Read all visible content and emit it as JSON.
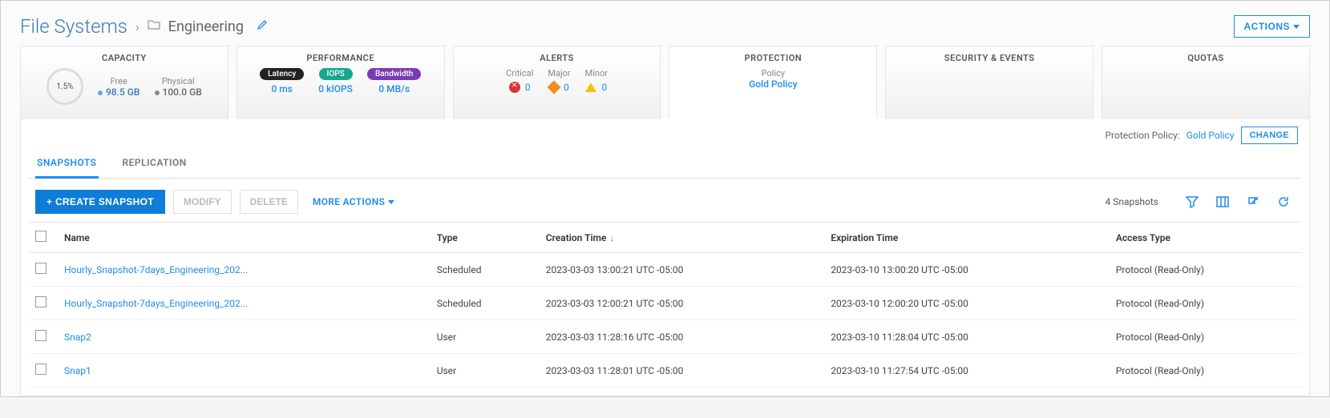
{
  "breadcrumb": {
    "root": "File Systems",
    "current": "Engineering"
  },
  "actions_button": "ACTIONS",
  "tabs": {
    "capacity": {
      "title": "CAPACITY",
      "usage_pct": "1.5%",
      "free_label": "Free",
      "free_value": "98.5 GB",
      "physical_label": "Physical",
      "physical_value": "100.0 GB"
    },
    "performance": {
      "title": "PERFORMANCE",
      "latency_label": "Latency",
      "latency_value": "0 ms",
      "iops_label": "IOPS",
      "iops_value": "0 kIOPS",
      "bandwidth_label": "Bandwidth",
      "bandwidth_value": "0 MB/s"
    },
    "alerts": {
      "title": "ALERTS",
      "critical_label": "Critical",
      "critical_value": "0",
      "major_label": "Major",
      "major_value": "0",
      "minor_label": "Minor",
      "minor_value": "0"
    },
    "protection": {
      "title": "PROTECTION",
      "policy_label": "Policy",
      "policy_value": "Gold Policy"
    },
    "security": {
      "title": "SECURITY & EVENTS"
    },
    "quotas": {
      "title": "QUOTAS"
    }
  },
  "policy_line": {
    "label": "Protection Policy:",
    "value": "Gold Policy",
    "change_btn": "CHANGE"
  },
  "subtabs": {
    "snapshots": "SNAPSHOTS",
    "replication": "REPLICATION"
  },
  "toolbar": {
    "create": "CREATE SNAPSHOT",
    "modify": "MODIFY",
    "delete": "DELETE",
    "more": "MORE ACTIONS",
    "count": "4 Snapshots"
  },
  "columns": {
    "name": "Name",
    "type": "Type",
    "creation": "Creation Time",
    "expiration": "Expiration Time",
    "access": "Access Type"
  },
  "rows": [
    {
      "name": "Hourly_Snapshot-7days_Engineering_202...",
      "type": "Scheduled",
      "creation": "2023-03-03 13:00:21 UTC -05:00",
      "expiration": "2023-03-10 13:00:20 UTC -05:00",
      "access": "Protocol (Read-Only)"
    },
    {
      "name": "Hourly_Snapshot-7days_Engineering_202...",
      "type": "Scheduled",
      "creation": "2023-03-03 12:00:21 UTC -05:00",
      "expiration": "2023-03-10 12:00:20 UTC -05:00",
      "access": "Protocol (Read-Only)"
    },
    {
      "name": "Snap2",
      "type": "User",
      "creation": "2023-03-03 11:28:16 UTC -05:00",
      "expiration": "2023-03-10 11:28:04 UTC -05:00",
      "access": "Protocol (Read-Only)"
    },
    {
      "name": "Snap1",
      "type": "User",
      "creation": "2023-03-03 11:28:01 UTC -05:00",
      "expiration": "2023-03-10 11:27:54 UTC -05:00",
      "access": "Protocol (Read-Only)"
    }
  ]
}
